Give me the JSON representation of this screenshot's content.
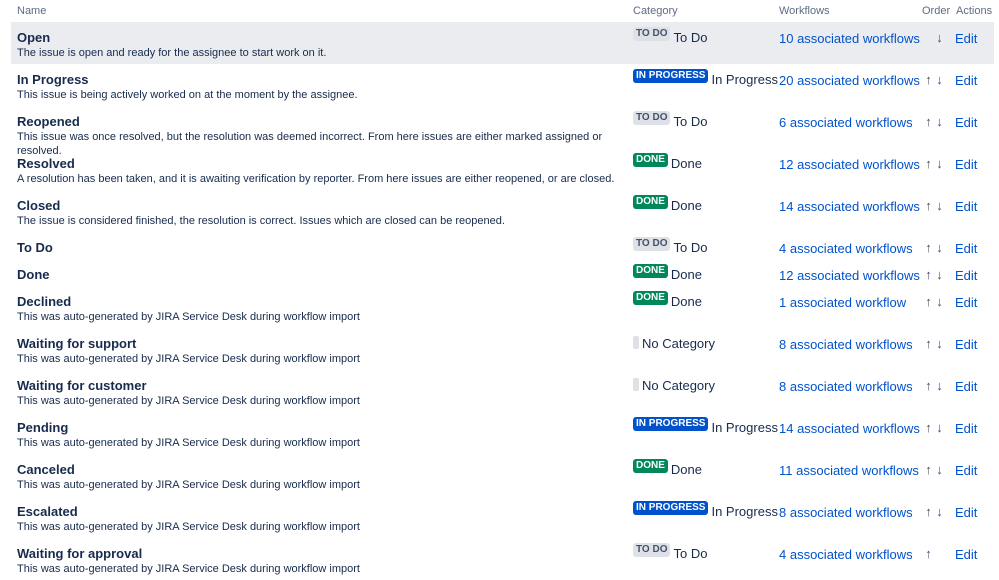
{
  "header": {
    "name": "Name",
    "category": "Category",
    "workflows": "Workflows",
    "order": "Order",
    "actions": "Actions"
  },
  "arrows": {
    "up": "↑",
    "down": "↓"
  },
  "statuses": [
    {
      "name": "Open",
      "description": "The issue is open and ready for the assignee to start work on it.",
      "lozenge": "TO DO",
      "lozenge_kind": "todo",
      "category": "To Do",
      "workflows": "10 associated workflows",
      "edit": "Edit"
    },
    {
      "name": "In Progress",
      "description": "This issue is being actively worked on at the moment by the assignee.",
      "lozenge": "IN PROGRESS",
      "lozenge_kind": "prog",
      "category": "In Progress",
      "workflows": "20 associated workflows",
      "edit": "Edit"
    },
    {
      "name": "Reopened",
      "description": "This issue was once resolved, but the resolution was deemed incorrect. From here issues are either marked assigned or resolved.",
      "lozenge": "TO DO",
      "lozenge_kind": "todo",
      "category": "To Do",
      "workflows": "6 associated workflows",
      "edit": "Edit"
    },
    {
      "name": "Resolved",
      "description": "A resolution has been taken, and it is awaiting verification by reporter. From here issues are either reopened, or are closed.",
      "lozenge": "DONE",
      "lozenge_kind": "done",
      "category": "Done",
      "workflows": "12 associated workflows",
      "edit": "Edit"
    },
    {
      "name": "Closed",
      "description": "The issue is considered finished, the resolution is correct. Issues which are closed can be reopened.",
      "lozenge": "DONE",
      "lozenge_kind": "done",
      "category": "Done",
      "workflows": "14 associated workflows",
      "edit": "Edit"
    },
    {
      "name": "To Do",
      "description": "",
      "lozenge": "TO DO",
      "lozenge_kind": "todo",
      "category": "To Do",
      "workflows": "4 associated workflows",
      "edit": "Edit"
    },
    {
      "name": "Done",
      "description": "",
      "lozenge": "DONE",
      "lozenge_kind": "done",
      "category": "Done",
      "workflows": "12 associated workflows",
      "edit": "Edit"
    },
    {
      "name": "Declined",
      "description": "This was auto-generated by JIRA Service Desk during workflow import",
      "lozenge": "DONE",
      "lozenge_kind": "done",
      "category": "Done",
      "workflows": "1 associated workflow",
      "edit": "Edit"
    },
    {
      "name": "Waiting for support",
      "description": "This was auto-generated by JIRA Service Desk during workflow import",
      "lozenge": "",
      "lozenge_kind": "none",
      "category": "No Category",
      "workflows": "8 associated workflows",
      "edit": "Edit"
    },
    {
      "name": "Waiting for customer",
      "description": "This was auto-generated by JIRA Service Desk during workflow import",
      "lozenge": "",
      "lozenge_kind": "none",
      "category": "No Category",
      "workflows": "8 associated workflows",
      "edit": "Edit"
    },
    {
      "name": "Pending",
      "description": "This was auto-generated by JIRA Service Desk during workflow import",
      "lozenge": "IN PROGRESS",
      "lozenge_kind": "prog",
      "category": "In Progress",
      "workflows": "14 associated workflows",
      "edit": "Edit"
    },
    {
      "name": "Canceled",
      "description": "This was auto-generated by JIRA Service Desk during workflow import",
      "lozenge": "DONE",
      "lozenge_kind": "done",
      "category": "Done",
      "workflows": "11 associated workflows",
      "edit": "Edit"
    },
    {
      "name": "Escalated",
      "description": "This was auto-generated by JIRA Service Desk during workflow import",
      "lozenge": "IN PROGRESS",
      "lozenge_kind": "prog",
      "category": "In Progress",
      "workflows": "8 associated workflows",
      "edit": "Edit"
    },
    {
      "name": "Waiting for approval",
      "description": "This was auto-generated by JIRA Service Desk during workflow import",
      "lozenge": "TO DO",
      "lozenge_kind": "todo",
      "category": "To Do",
      "workflows": "4 associated workflows",
      "edit": "Edit"
    }
  ]
}
